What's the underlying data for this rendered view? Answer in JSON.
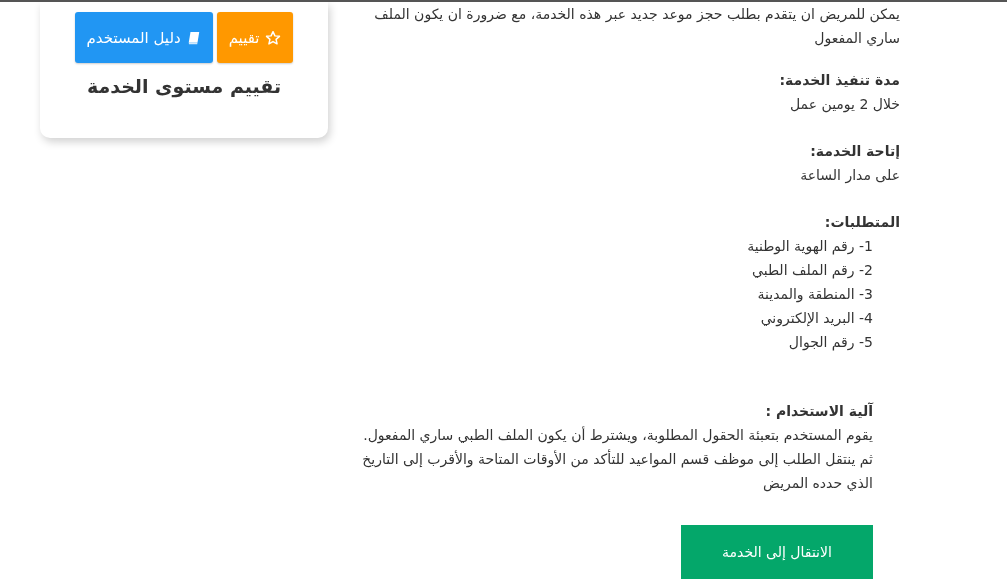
{
  "service_card": {
    "buttons": [
      {
        "kind": "rating",
        "label": "تقييم"
      },
      {
        "kind": "guide",
        "label": "دليل المستخدم"
      }
    ],
    "title": "تقييم مستوى الخدمة"
  },
  "description": "يمكن للمريض ان يتقدم بطلب حجز موعد جديد عبر هذه الخدمة، مع ضرورة ان يكون الملف ساري المفعول",
  "sections": [
    {
      "kind": "text",
      "heading": "مدة تنفيذ الخدمة:",
      "text": "خلال 2 يومين عمل"
    },
    {
      "kind": "text",
      "heading": "إتاحة الخدمة:",
      "text": "على مدار الساعة"
    },
    {
      "kind": "list",
      "heading": "المتطلبات:",
      "items": [
        "1- رقم الهوية الوطنية",
        "2- رقم الملف الطبي",
        "3- المنطقة والمدينة",
        "4- البريد الإلكتروني",
        "5- رقم الجوال"
      ]
    }
  ],
  "usage": {
    "heading": "آلية الاستخدام :",
    "text": " يقوم المستخدم بتعبئة الحقول المطلوبة، ويشترط أن يكون الملف الطبي ساري المفعول. ثم ينتقل الطلب إلى موظف قسم المواعيد للتأكد من الأوقات المتاحة والأقرب إلى التاريخ الذي حدده المريض"
  },
  "service_button": "الانتقال إلى الخدمة"
}
